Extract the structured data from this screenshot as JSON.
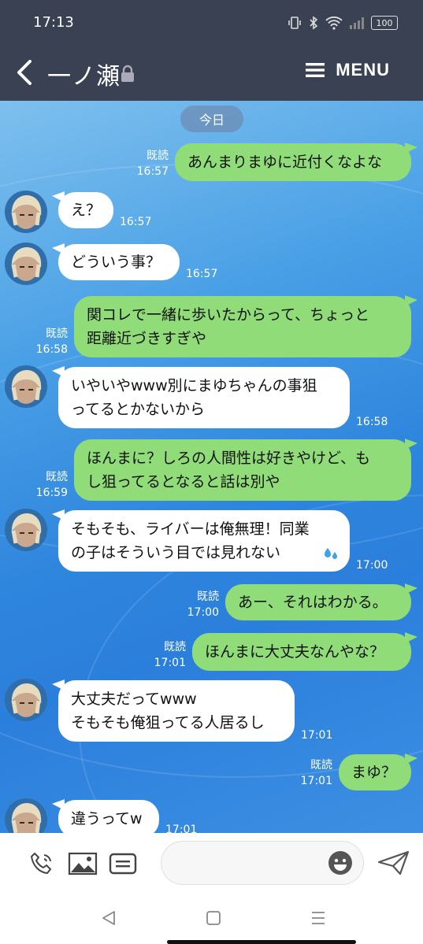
{
  "status_bar": {
    "time": "17:13",
    "battery": "100"
  },
  "header": {
    "title": "一ノ瀬",
    "menu_label": "MENU"
  },
  "chat": {
    "date_label": "今日",
    "messages": [
      {
        "dir": "out",
        "text": "あんまりまゆに近付くなよな",
        "read": "既読",
        "time": "16:57"
      },
      {
        "dir": "in",
        "text": "え？",
        "time": "16:57"
      },
      {
        "dir": "in",
        "text": "どういう事？",
        "time": "16:57"
      },
      {
        "dir": "out",
        "text": "関コレで一緒に歩いたからって、ちょっと\n距離近づきすぎや",
        "read": "既読",
        "time": "16:58"
      },
      {
        "dir": "in",
        "text": "いやいやwww別にまゆちゃんの事狙\nってるとかないから",
        "time": "16:58"
      },
      {
        "dir": "out",
        "text": "ほんまに？しろの人間性は好きやけど、も\nし狙ってるとなると話は別や",
        "read": "既読",
        "time": "16:59"
      },
      {
        "dir": "in",
        "text": "そもそも、ライバーは俺無理！同業\nの子はそういう目では見れない",
        "time": "17:00"
      },
      {
        "dir": "out",
        "text": "あー、それはわかる。",
        "read": "既読",
        "time": "17:00"
      },
      {
        "dir": "out",
        "text": "ほんまに大丈夫なんやな？",
        "read": "既読",
        "time": "17:01"
      },
      {
        "dir": "in",
        "text": "大丈夫だってwww\nそもそも俺狙ってる人居るし",
        "time": "17:01"
      },
      {
        "dir": "out",
        "text": "まゆ？",
        "read": "既読",
        "time": "17:01"
      },
      {
        "dir": "in",
        "text": "違うってw",
        "time": "17:01"
      }
    ]
  },
  "input": {
    "placeholder": ""
  },
  "icons": {
    "back": "chevron-left-icon",
    "lock": "lock-icon",
    "menu": "hamburger-icon",
    "call": "phone-icon",
    "image": "image-icon",
    "stamp": "sticker-icon",
    "emoji": "emoji-icon",
    "send": "send-icon"
  },
  "colors": {
    "header_bg": "#3a4152",
    "out_bubble": "#8fdc78",
    "in_bubble": "#ffffff",
    "sweat_drop": "#3ba3e8"
  }
}
